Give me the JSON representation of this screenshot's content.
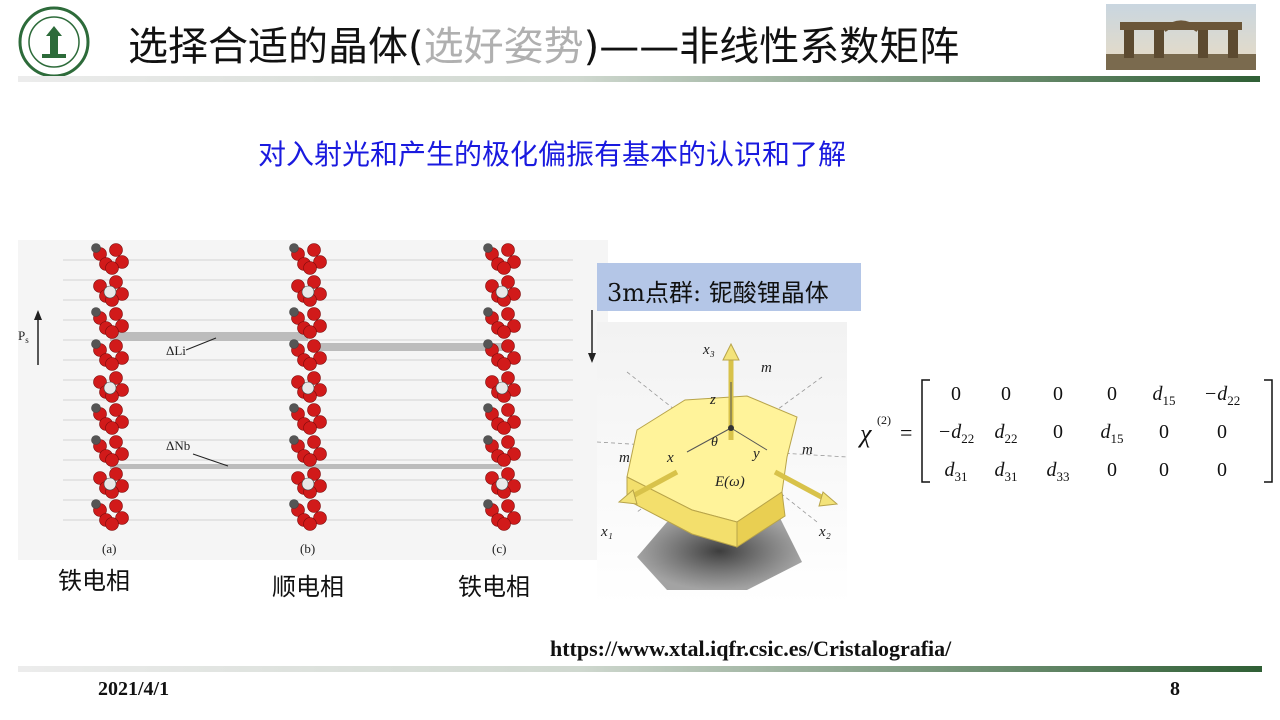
{
  "header": {
    "logo_text": "中山大学 SUN YAT-SEN UNIVERSITY",
    "title_main": "选择合适的晶体(",
    "title_gray": "选好姿势",
    "title_end": ")——非线性系数矩阵"
  },
  "subtitle": "对入射光和产生的极化偏振有基本的认识和了解",
  "left_figure": {
    "ps_label": "P",
    "ps_sub": "s",
    "delta_li": "ΔLi",
    "delta_nb": "ΔNb",
    "panel_a": "(a)",
    "panel_b": "(b)",
    "panel_c": "(c)",
    "phase_a": "铁电相",
    "phase_b": "顺电相",
    "phase_c": "铁电相"
  },
  "point_group_label": "3m点群: 铌酸锂晶体",
  "crystal_figure": {
    "x1": "x₁",
    "x2": "x₂",
    "x3": "x₃",
    "m": "m",
    "x": "x",
    "y": "y",
    "z": "z",
    "theta": "θ",
    "e_omega": "E(ω)"
  },
  "matrix": {
    "chi": "χ",
    "sup": "(2)",
    "eq": "=",
    "rows": [
      [
        "0",
        "0",
        "0",
        "0",
        "d15",
        "−d22"
      ],
      [
        "−d22",
        "d22",
        "0",
        "d15",
        "0",
        "0"
      ],
      [
        "d31",
        "d31",
        "d33",
        "0",
        "0",
        "0"
      ]
    ]
  },
  "source_url": "https://www.xtal.iqfr.csic.es/Cristalografia/",
  "footer": {
    "date": "2021/4/1",
    "page": "8"
  },
  "colors": {
    "subtitle_blue": "#1a1adf",
    "label_box": "#b4c6e7",
    "rule_green": "#2f5f35",
    "atom_red": "#d11a1a"
  }
}
